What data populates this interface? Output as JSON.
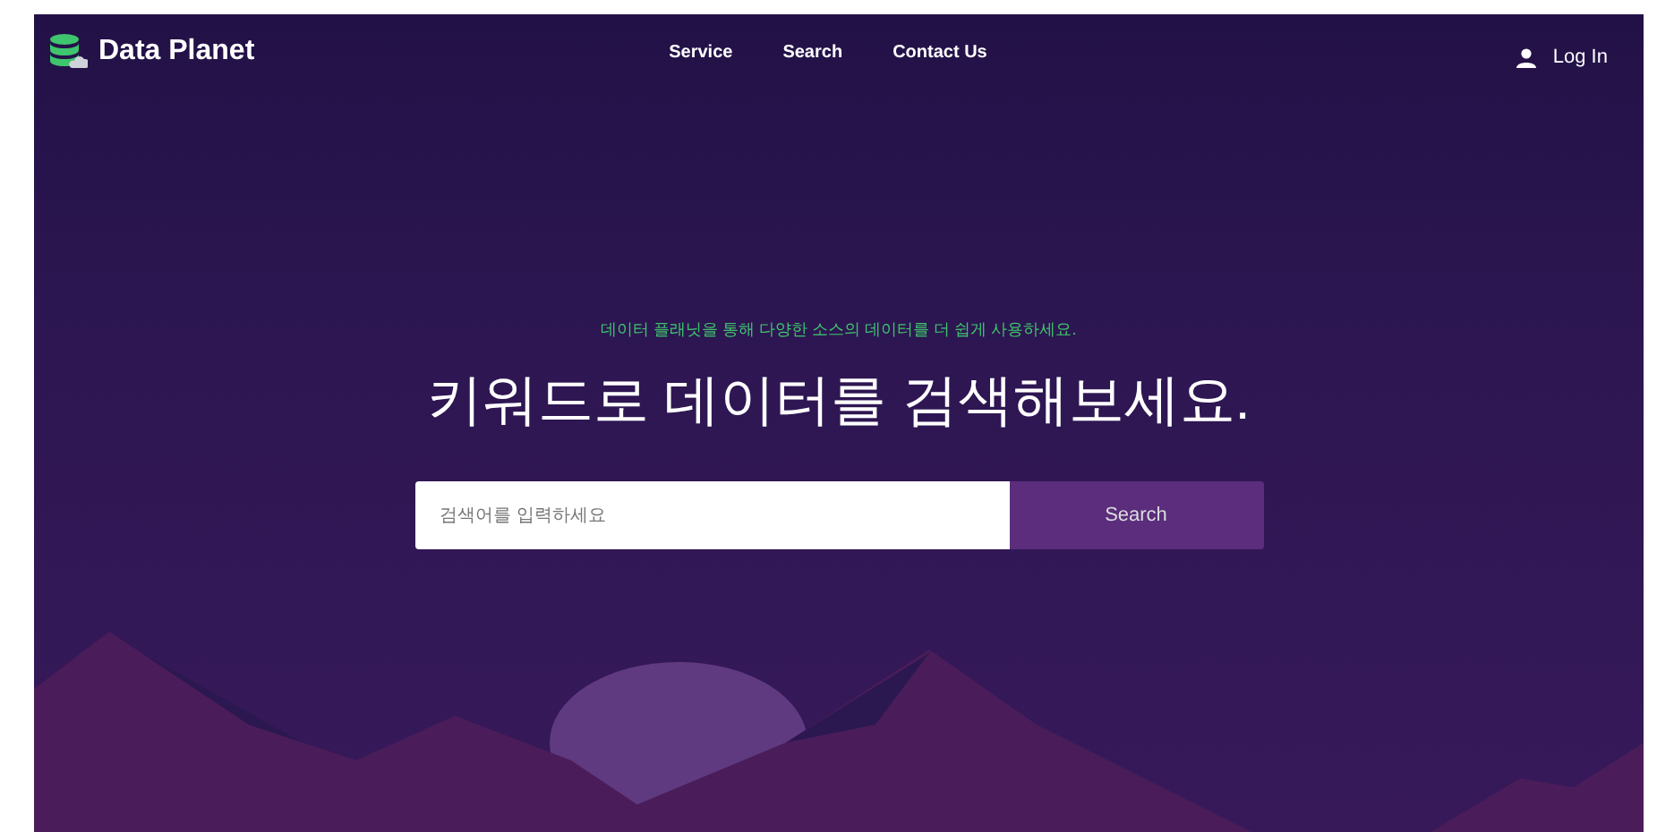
{
  "brand": {
    "name": "Data Planet"
  },
  "nav": {
    "links": [
      "Service",
      "Search",
      "Contact Us"
    ],
    "login": "Log In"
  },
  "hero": {
    "tagline": "데이터 플래닛을 통해 다양한 소스의 데이터를 더 쉽게 사용하세요.",
    "heading": "키워드로 데이터를 검색해보세요.",
    "search": {
      "placeholder": "검색어를 입력하세요",
      "button": "Search"
    }
  }
}
